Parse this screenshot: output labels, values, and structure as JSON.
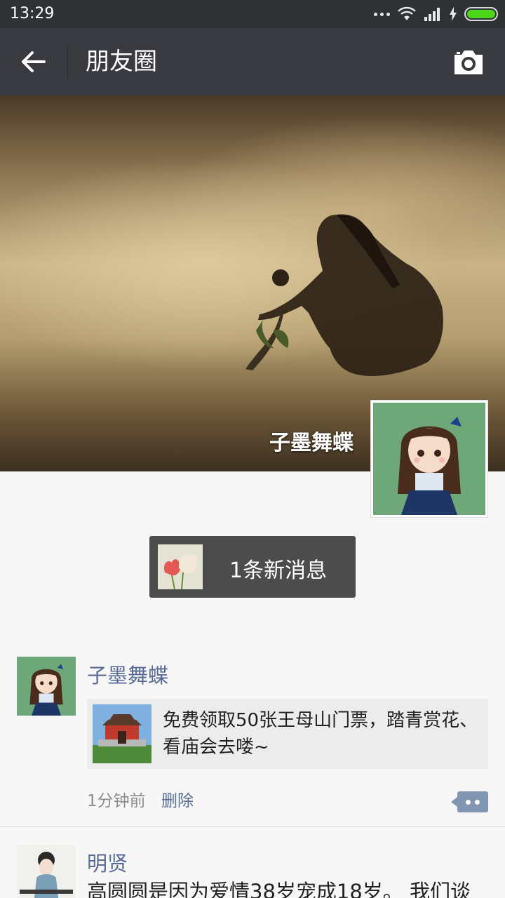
{
  "status_bar": {
    "time": "13:29"
  },
  "header": {
    "title": "朋友圈"
  },
  "cover": {
    "username": "子墨舞蝶"
  },
  "new_message": {
    "text": "1条新消息"
  },
  "posts": [
    {
      "author": "子墨舞蝶",
      "link_text": "免费领取50张王母山门票，踏青赏花、看庙会去喽~",
      "time": "1分钟前",
      "delete_label": "删除"
    },
    {
      "author": "明贤",
      "text": "高圆圆是因为爱情38岁宠成18岁。 我们谈"
    }
  ],
  "colors": {
    "link_blue": "#576b95",
    "app_bar": "#393a3f",
    "status_bar": "#2f3235",
    "battery_green": "#4cd61a"
  }
}
